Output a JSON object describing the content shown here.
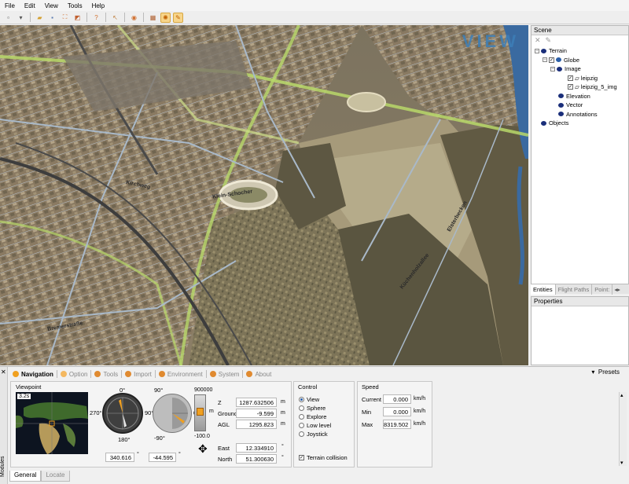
{
  "menu": [
    "File",
    "Edit",
    "View",
    "Tools",
    "Help"
  ],
  "viewport": {
    "logo": "VIEW",
    "street_labels": [
      "Klein-Schocher",
      "Kirchweg",
      "Küchenholzallee",
      "Bremerstraße",
      "Elsterbecken"
    ]
  },
  "scene": {
    "title": "Scene",
    "tree": [
      {
        "label": "Terrain",
        "level": 0
      },
      {
        "label": "Globe",
        "level": 1,
        "checked": true
      },
      {
        "label": "Image",
        "level": 2
      },
      {
        "label": "leipzig",
        "level": 3,
        "checked": true
      },
      {
        "label": "leipzig_5_img",
        "level": 3,
        "checked": true
      },
      {
        "label": "Elevation",
        "level": 2
      },
      {
        "label": "Vector",
        "level": 2
      },
      {
        "label": "Annotations",
        "level": 2
      },
      {
        "label": "Objects",
        "level": 0
      }
    ],
    "tabs": [
      "Entities",
      "Flight Paths",
      "Point:"
    ]
  },
  "properties": {
    "title": "Properties"
  },
  "module_tabs": [
    "Navigation",
    "Option",
    "Tools",
    "Import",
    "Environment",
    "System",
    "About"
  ],
  "presets": "Presets",
  "navigation": {
    "viewpoint_label": "Viewpoint",
    "minimap_scale": "3.2s",
    "compass": {
      "n": "0°",
      "e": "90°",
      "s": "180°",
      "w": "270°"
    },
    "heading_value": "340.616",
    "tilt": {
      "top": "90°",
      "right": "0°",
      "bottom": "-90°"
    },
    "tilt_value": "-44.595",
    "altitude": {
      "top": "900000",
      "bottom": "-100.0",
      "unit": "m"
    },
    "position": {
      "z_label": "Z",
      "z": "1287.632506",
      "ground_label": "Ground",
      "ground": "-9.599",
      "agl_label": "AGL",
      "agl": "1295.823",
      "east_label": "East",
      "east": "12.334910",
      "north_label": "North",
      "north": "51.300630",
      "unit_m": "m",
      "unit_deg": "°"
    }
  },
  "control": {
    "title": "Control",
    "options": [
      "View",
      "Sphere",
      "Explore",
      "Low level",
      "Joystick"
    ],
    "selected": "View",
    "terrain_collision": "Terrain collision"
  },
  "speed": {
    "title": "Speed",
    "current_label": "Current",
    "current": "0.000",
    "min_label": "Min",
    "min": "0.000",
    "max_label": "Max",
    "max": "8319.502",
    "unit": "km/h"
  },
  "bottom_tabs": [
    "General",
    "Locate"
  ],
  "modules_label": "Modules",
  "colors": {
    "accent": "#f0a020",
    "road_green": "#b8d86a",
    "tree_node": "#1a2e7a"
  }
}
